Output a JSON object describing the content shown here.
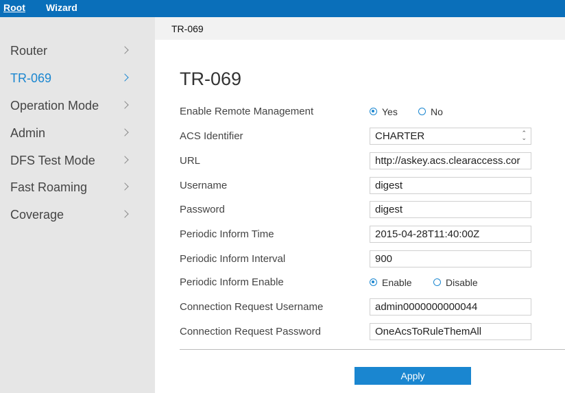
{
  "topnav": {
    "root": "Root",
    "wizard": "Wizard"
  },
  "sidebar": {
    "items": [
      {
        "label": "Router"
      },
      {
        "label": "TR-069"
      },
      {
        "label": "Operation Mode"
      },
      {
        "label": "Admin"
      },
      {
        "label": "DFS Test Mode"
      },
      {
        "label": "Fast Roaming"
      },
      {
        "label": "Coverage"
      }
    ],
    "active": "TR-069"
  },
  "breadcrumb": "TR-069",
  "page_title": "TR-069",
  "form": {
    "enable_remote_management": {
      "label": "Enable Remote Management",
      "options": [
        "Yes",
        "No"
      ],
      "selected": "Yes"
    },
    "acs_identifier": {
      "label": "ACS Identifier",
      "value": "CHARTER"
    },
    "url": {
      "label": "URL",
      "value": "http://askey.acs.clearaccess.cor"
    },
    "username": {
      "label": "Username",
      "value": "digest"
    },
    "password": {
      "label": "Password",
      "value": "digest"
    },
    "periodic_inform_time": {
      "label": "Periodic Inform Time",
      "value": "2015-04-28T11:40:00Z"
    },
    "periodic_inform_interval": {
      "label": "Periodic Inform Interval",
      "value": "900"
    },
    "periodic_inform_enable": {
      "label": "Periodic Inform Enable",
      "options": [
        "Enable",
        "Disable"
      ],
      "selected": "Enable"
    },
    "connection_request_username": {
      "label": "Connection Request Username",
      "value": "admin0000000000044"
    },
    "connection_request_password": {
      "label": "Connection Request Password",
      "value": "OneAcsToRuleThemAll"
    }
  },
  "apply_label": "Apply",
  "colors": {
    "accent": "#1a86d0",
    "topbar": "#0a6fba",
    "sidebar_bg": "#e6e6e6"
  }
}
